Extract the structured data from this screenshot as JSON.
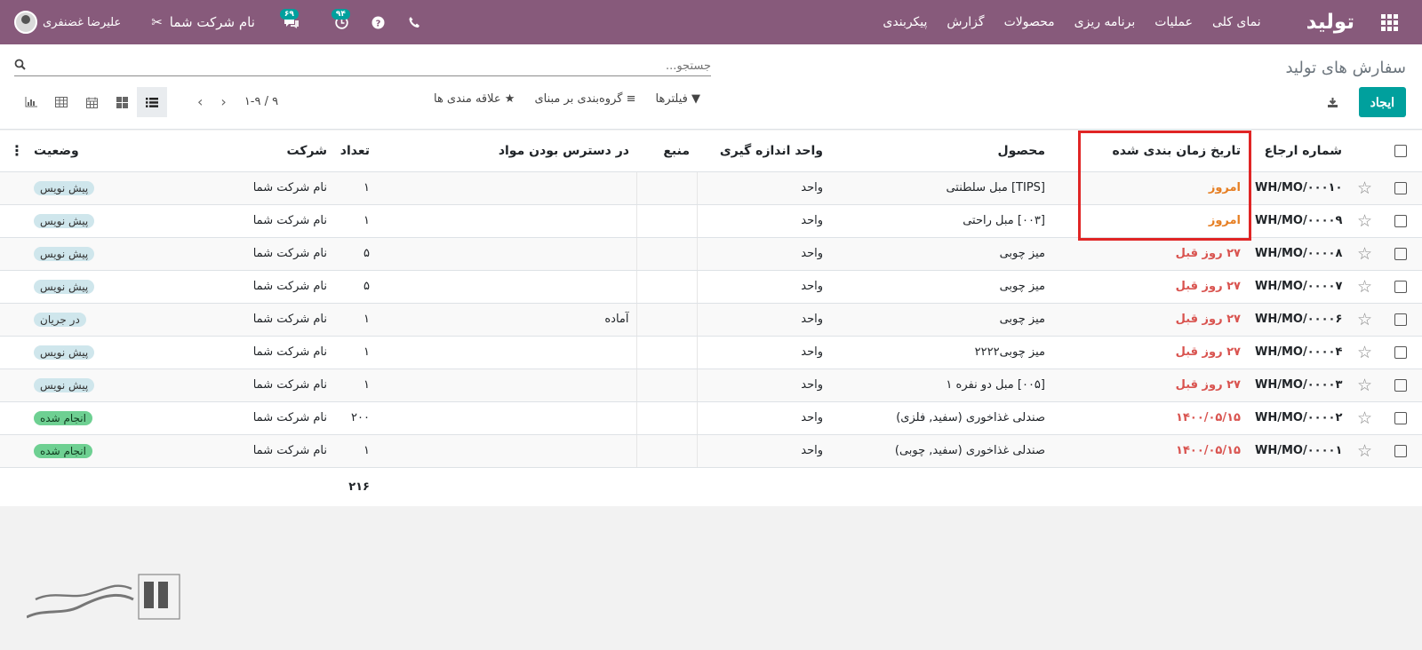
{
  "navbar": {
    "brand": "تولید",
    "menu": [
      "نمای کلی",
      "عملیات",
      "برنامه ریزی",
      "محصولات",
      "گزارش",
      "پیکربندی"
    ],
    "user_name": "علیرضا غضنفری",
    "company_name": "نام شرکت شما",
    "badge_activities": "۹۴",
    "badge_messages": "۶۹",
    "bg_color": "#875a7b"
  },
  "control": {
    "title": "سفارش های تولید",
    "search_placeholder": "جستجو...",
    "create_label": "ایجاد",
    "filters_label": "فیلترها",
    "groupby_label": "گروه‌بندی بر مبنای",
    "favorites_label": "علاقه مندی ها",
    "pager": "۱-۹ / ۹"
  },
  "table": {
    "headers": {
      "reference": "شماره ارجاع",
      "scheduled_date": "تاریخ زمان بندی شده",
      "product": "محصول",
      "uom": "واحد اندازه گیری",
      "source": "منبع",
      "availability": "در دسترس بودن مواد",
      "quantity": "تعداد",
      "company": "شرکت",
      "state": "وضعیت"
    },
    "rows": [
      {
        "ref": "WH/MO/۰۰۰۱۰",
        "date": "امروز",
        "date_kind": "today",
        "product": "[TIPS] مبل سلطنتی",
        "uom": "واحد",
        "source": "",
        "availability": "",
        "qty": "۱",
        "company": "نام شرکت شما",
        "state": "پیش نویس",
        "state_kind": "draft"
      },
      {
        "ref": "WH/MO/۰۰۰۰۹",
        "date": "امروز",
        "date_kind": "today",
        "product": "[۰۰۳] مبل راحتی",
        "uom": "واحد",
        "source": "",
        "availability": "",
        "qty": "۱",
        "company": "نام شرکت شما",
        "state": "پیش نویس",
        "state_kind": "draft"
      },
      {
        "ref": "WH/MO/۰۰۰۰۸",
        "date": "۲۷ روز قبل",
        "date_kind": "late",
        "product": "میز چوبی",
        "uom": "واحد",
        "source": "",
        "availability": "",
        "qty": "۵",
        "company": "نام شرکت شما",
        "state": "پیش نویس",
        "state_kind": "draft"
      },
      {
        "ref": "WH/MO/۰۰۰۰۷",
        "date": "۲۷ روز قبل",
        "date_kind": "late",
        "product": "میز چوبی",
        "uom": "واحد",
        "source": "",
        "availability": "",
        "qty": "۵",
        "company": "نام شرکت شما",
        "state": "پیش نویس",
        "state_kind": "draft"
      },
      {
        "ref": "WH/MO/۰۰۰۰۶",
        "date": "۲۷ روز قبل",
        "date_kind": "late",
        "product": "میز چوبی",
        "uom": "واحد",
        "source": "",
        "availability": "آماده",
        "qty": "۱",
        "company": "نام شرکت شما",
        "state": "در جریان",
        "state_kind": "progress"
      },
      {
        "ref": "WH/MO/۰۰۰۰۴",
        "date": "۲۷ روز قبل",
        "date_kind": "late",
        "product": "میز چوبی۲۲۲۲",
        "uom": "واحد",
        "source": "",
        "availability": "",
        "qty": "۱",
        "company": "نام شرکت شما",
        "state": "پیش نویس",
        "state_kind": "draft"
      },
      {
        "ref": "WH/MO/۰۰۰۰۳",
        "date": "۲۷ روز قبل",
        "date_kind": "late",
        "product": "[۰۰۵] مبل دو نفره ۱",
        "uom": "واحد",
        "source": "",
        "availability": "",
        "qty": "۱",
        "company": "نام شرکت شما",
        "state": "پیش نویس",
        "state_kind": "draft"
      },
      {
        "ref": "WH/MO/۰۰۰۰۲",
        "date": "۱۴۰۰/۰۵/۱۵",
        "date_kind": "late",
        "product": "صندلی غذاخوری (سفید, فلزی)",
        "uom": "واحد",
        "source": "",
        "availability": "",
        "qty": "۲۰۰",
        "company": "نام شرکت شما",
        "state": "انجام شده",
        "state_kind": "done"
      },
      {
        "ref": "WH/MO/۰۰۰۰۱",
        "date": "۱۴۰۰/۰۵/۱۵",
        "date_kind": "late",
        "product": "صندلی غذاخوری (سفید, چوبی)",
        "uom": "واحد",
        "source": "",
        "availability": "",
        "qty": "۱",
        "company": "نام شرکت شما",
        "state": "انجام شده",
        "state_kind": "done"
      }
    ],
    "total_qty": "۲۱۶"
  },
  "colors": {
    "accent": "#00a09d",
    "today": "#e67e22",
    "late": "#d9534f",
    "highlight": "#e02525"
  }
}
